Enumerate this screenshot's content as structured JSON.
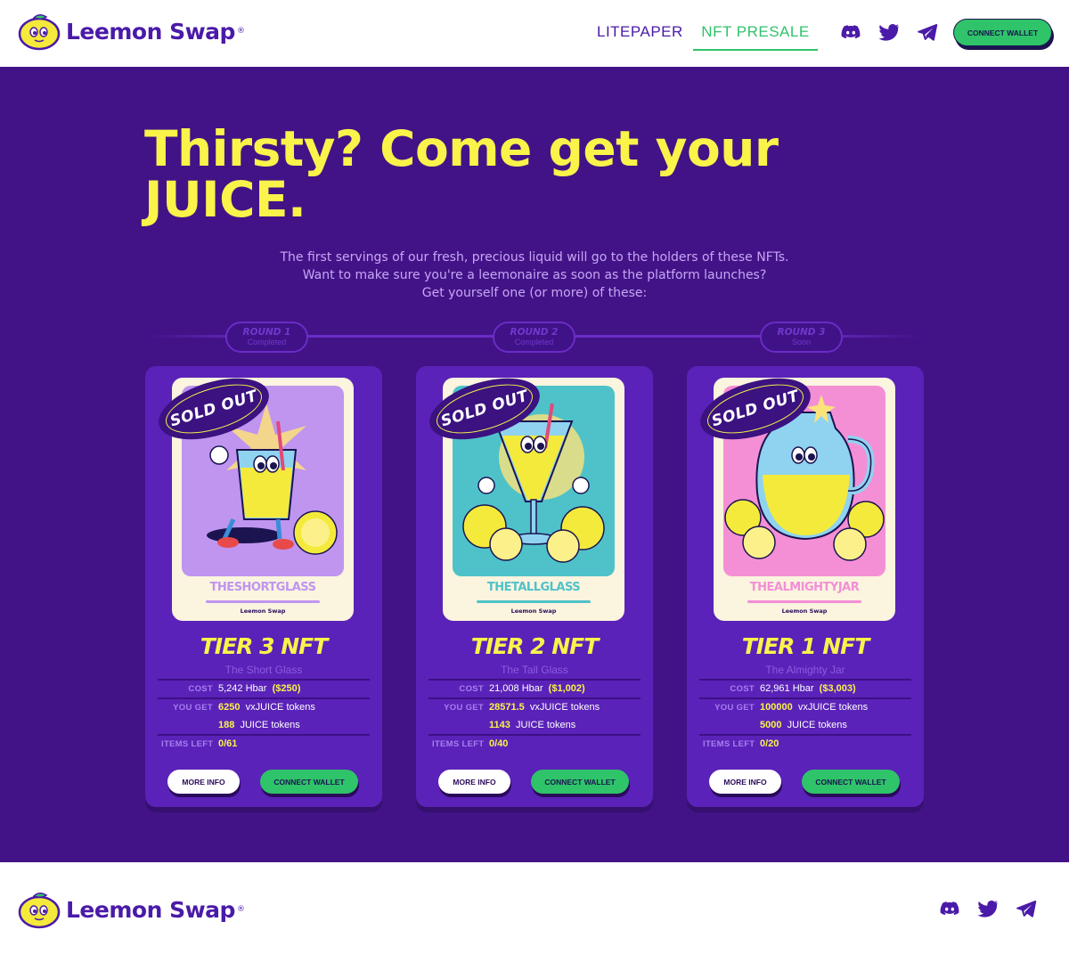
{
  "header": {
    "brand": "Leemon Swap",
    "reg_mark": "®",
    "nav": {
      "litepaper": "LITEPAPER",
      "nft_presale": "NFT PRESALE"
    },
    "social": [
      "discord-icon",
      "twitter-icon",
      "telegram-icon"
    ],
    "connect_wallet": "CONNECT WALLET"
  },
  "hero": {
    "headline_line1": "Thirsty? Come get your",
    "headline_line2": "JUICE.",
    "intro": [
      "The first servings of our fresh, precious liquid will go to the holders of these NFTs.",
      "Want to make sure you're a leemonaire as soon as the platform launches?",
      "Get yourself one (or more) of these:"
    ]
  },
  "rounds": [
    {
      "title": "ROUND 1",
      "status": "Completed"
    },
    {
      "title": "ROUND 2",
      "status": "Completed"
    },
    {
      "title": "ROUND 3",
      "status": "Soon"
    }
  ],
  "cards": [
    {
      "badge": "SOLD OUT",
      "art_name": "THESHORTGLASS",
      "art_brand": "Leemon Swap",
      "tier": "TIER 3 NFT",
      "subtitle": "The Short Glass",
      "cost_label": "COST",
      "cost_hbar": "5,242 Hbar",
      "cost_usd": "($250)",
      "you_get_label": "YOU GET",
      "vx_amount": "6250",
      "vx_unit": "vxJUICE tokens",
      "juice_amount": "188",
      "juice_unit": "JUICE tokens",
      "items_left_label": "ITEMS LEFT",
      "items_left": "0/61",
      "more_info": "MORE INFO",
      "connect_wallet": "CONNECT WALLET",
      "accent": "#bf95f0"
    },
    {
      "badge": "SOLD OUT",
      "art_name": "THETALLGLASS",
      "art_brand": "Leemon Swap",
      "tier": "TIER 2 NFT",
      "subtitle": "The Tall Glass",
      "cost_label": "COST",
      "cost_hbar": "21,008 Hbar",
      "cost_usd": "($1,002)",
      "you_get_label": "YOU GET",
      "vx_amount": "28571.5",
      "vx_unit": "vxJUICE tokens",
      "juice_amount": "1143",
      "juice_unit": "JUICE tokens",
      "items_left_label": "ITEMS LEFT",
      "items_left": "0/40",
      "more_info": "MORE INFO",
      "connect_wallet": "CONNECT WALLET",
      "accent": "#4fc2c9"
    },
    {
      "badge": "SOLD OUT",
      "art_name": "THEALMIGHTYJAR",
      "art_brand": "Leemon Swap",
      "tier": "TIER 1 NFT",
      "subtitle": "The Almighty Jar",
      "cost_label": "COST",
      "cost_hbar": "62,961 Hbar",
      "cost_usd": "($3,003)",
      "you_get_label": "YOU GET",
      "vx_amount": "100000",
      "vx_unit": "vxJUICE tokens",
      "juice_amount": "5000",
      "juice_unit": "JUICE tokens",
      "items_left_label": "ITEMS LEFT",
      "items_left": "0/20",
      "more_info": "MORE INFO",
      "connect_wallet": "CONNECT WALLET",
      "accent": "#f48fd6"
    }
  ],
  "footer": {
    "brand": "Leemon Swap",
    "reg_mark": "®",
    "social": [
      "discord-icon",
      "twitter-icon",
      "telegram-icon"
    ]
  },
  "colors": {
    "brand_purple": "#4a1aa8",
    "hero_bg": "#421387",
    "card_bg": "#5a22b8",
    "headline_yellow": "#f9f34a",
    "green": "#2fc36a"
  }
}
